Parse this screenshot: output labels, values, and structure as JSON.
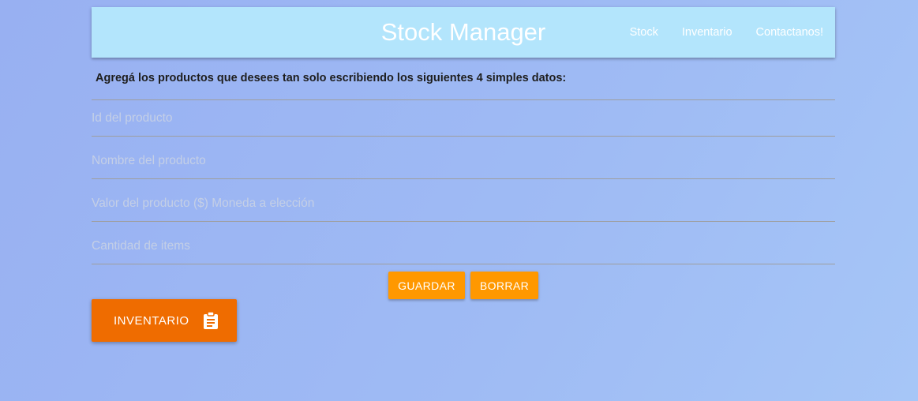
{
  "navbar": {
    "brand": "Stock Manager",
    "links": [
      "Stock",
      "Inventario",
      "Contactanos!"
    ]
  },
  "form": {
    "intro": "Agregá los productos que desees tan solo escribiendo los siguientes 4 simples datos:",
    "fields": [
      {
        "placeholder": "Id del producto",
        "value": ""
      },
      {
        "placeholder": "Nombre del producto",
        "value": ""
      },
      {
        "placeholder": "Valor del producto ($) Moneda a elección",
        "value": ""
      },
      {
        "placeholder": "Cantidad de items",
        "value": ""
      }
    ],
    "save_label": "Guardar",
    "delete_label": "Borrar"
  },
  "inventory_button": {
    "label": "Inventario",
    "icon": "clipboard-icon"
  },
  "colors": {
    "navbar_bg": "#b3e5fc",
    "button_small": "#ff9800",
    "button_large": "#ef6c00"
  }
}
